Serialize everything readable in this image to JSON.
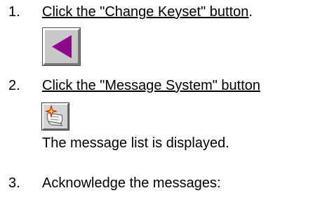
{
  "steps": [
    {
      "number": "1.",
      "prefix": "",
      "link_text": "Click the \"Change Keyset\" button",
      "suffix": ".",
      "button_icon": "left-arrow-icon",
      "button_color": "#8b0a8b"
    },
    {
      "number": "2.",
      "prefix": "",
      "link_text": "Click the \"Message System\" button",
      "suffix": "",
      "button_icon": "message-scroll-icon",
      "result_text": "The message list is displayed."
    },
    {
      "number": "3.",
      "text": "Acknowledge the messages:"
    }
  ],
  "colors": {
    "text": "#000000",
    "arrow": "#8b0a8b",
    "star_fill": "#ffd700",
    "star_outline": "#cc0000"
  }
}
